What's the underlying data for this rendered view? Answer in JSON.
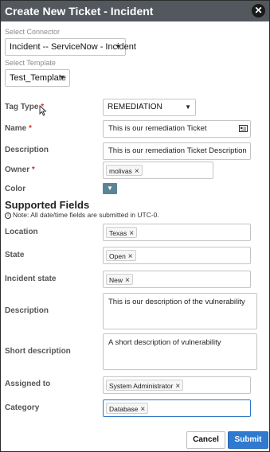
{
  "dialog": {
    "title": "Create New Ticket - Incident",
    "close_icon": "close-icon"
  },
  "connector": {
    "label": "Select Connector",
    "value": "Incident -- ServiceNow - Incident"
  },
  "template": {
    "label": "Select Template",
    "value": "Test_Template"
  },
  "fields": {
    "tag_type": {
      "label": "Tag Type",
      "required": "*",
      "value": "REMEDIATION"
    },
    "name": {
      "label": "Name",
      "required": "*",
      "value": "This is our remediation Ticket"
    },
    "description": {
      "label": "Description",
      "value": "This is our remediation Ticket Description"
    },
    "owner": {
      "label": "Owner",
      "required": "*",
      "chip": "molivas"
    },
    "color": {
      "label": "Color",
      "icon": "chevron-down-icon"
    }
  },
  "supported": {
    "title": "Supported Fields",
    "note": "Note: All date/time fields are submitted in UTC-0.",
    "location": {
      "label": "Location",
      "chip": "Texas"
    },
    "state": {
      "label": "State",
      "chip": "Open"
    },
    "incident_state": {
      "label": "Incident state",
      "chip": "New"
    },
    "description": {
      "label": "Description",
      "value": "This is our description of the vulnerability"
    },
    "short_description": {
      "label": "Short description",
      "value": "A short description of vulnerability"
    },
    "assigned_to": {
      "label": "Assigned to",
      "chip": "System Administrator"
    },
    "category": {
      "label": "Category",
      "chip": "Database"
    }
  },
  "chip_remove": "×",
  "buttons": {
    "cancel": "Cancel",
    "submit": "Submit"
  },
  "colors": {
    "titlebar": "#53585e",
    "required": "#d9302c",
    "submit": "#2f7ad0",
    "color_swatch": "#5b8497"
  }
}
